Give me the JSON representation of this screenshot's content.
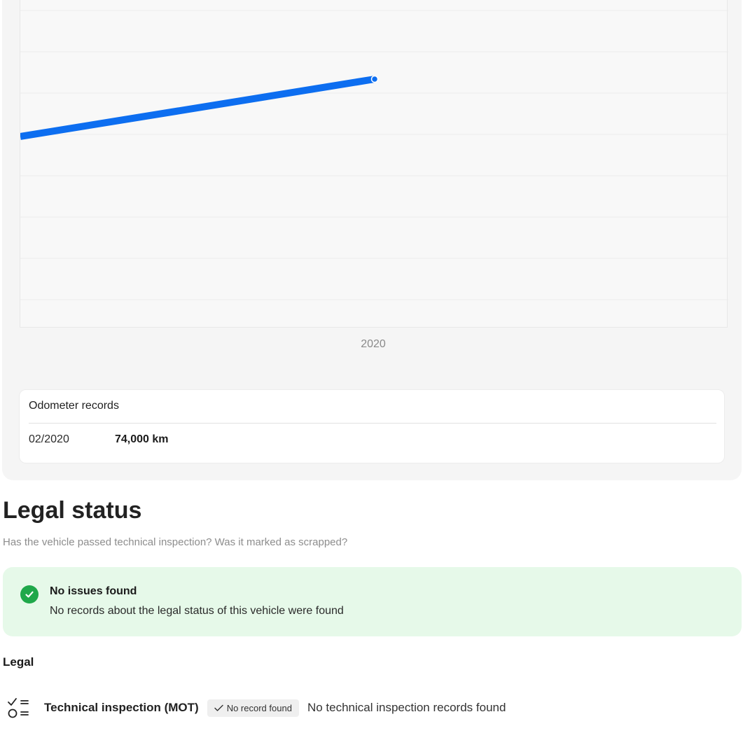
{
  "chart_data": {
    "type": "line",
    "x_tick_labels": [
      "2020"
    ],
    "series": [
      {
        "points_note": "",
        "color": "#0d6ef0"
      }
    ],
    "xlabel": "",
    "ylabel": "",
    "grid": true,
    "line_color": "#0d6ef0"
  },
  "odometer": {
    "title": "Odometer records",
    "records": [
      {
        "date": "02/2020",
        "value": "74,000 km"
      }
    ]
  },
  "legal_status": {
    "heading": "Legal status",
    "subtitle": "Has the vehicle passed technical inspection? Was it marked as scrapped?",
    "status": {
      "title": "No issues found",
      "text": "No records about the legal status of this vehicle were found",
      "color": "#1fa84a"
    }
  },
  "legal": {
    "label": "Legal",
    "items": [
      {
        "icon": "checklist-icon",
        "title": "Technical inspection (MOT)",
        "badge": "No record found",
        "text": "No technical inspection records found"
      }
    ]
  }
}
